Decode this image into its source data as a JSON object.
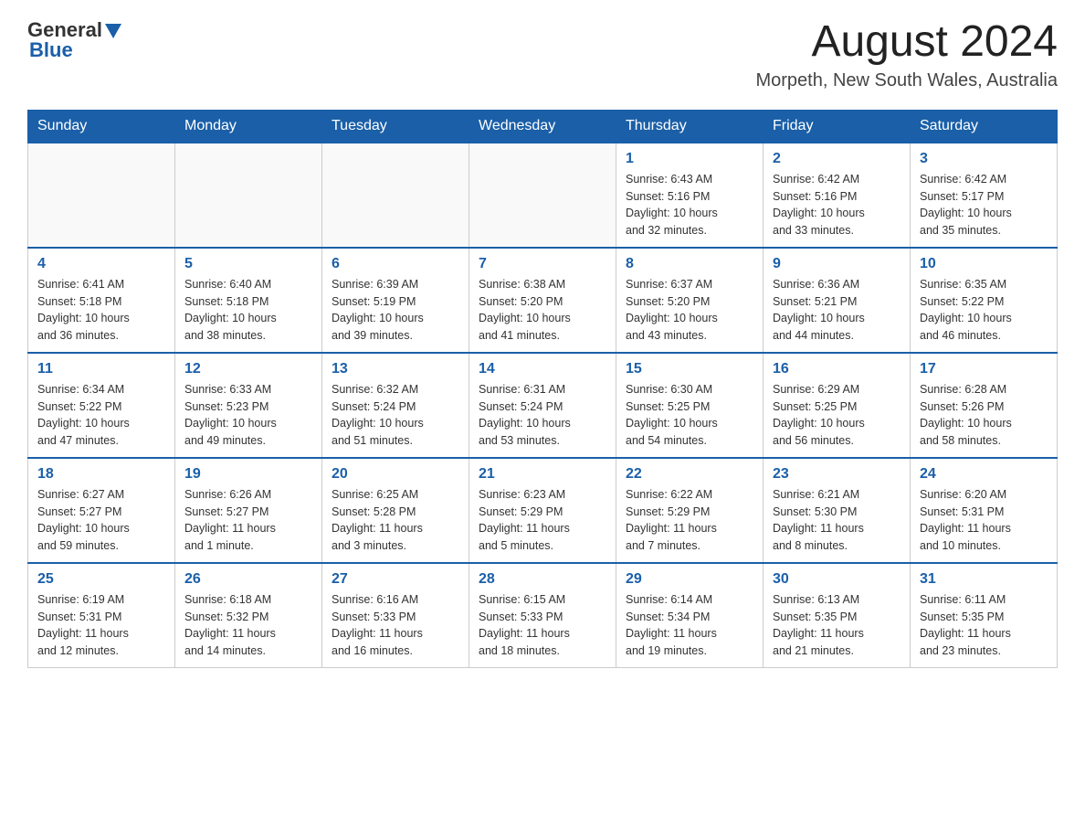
{
  "header": {
    "logo": {
      "general": "General",
      "blue": "Blue"
    },
    "title": "August 2024",
    "location": "Morpeth, New South Wales, Australia"
  },
  "days_of_week": [
    "Sunday",
    "Monday",
    "Tuesday",
    "Wednesday",
    "Thursday",
    "Friday",
    "Saturday"
  ],
  "weeks": [
    {
      "days": [
        {
          "number": "",
          "info": ""
        },
        {
          "number": "",
          "info": ""
        },
        {
          "number": "",
          "info": ""
        },
        {
          "number": "",
          "info": ""
        },
        {
          "number": "1",
          "info": "Sunrise: 6:43 AM\nSunset: 5:16 PM\nDaylight: 10 hours\nand 32 minutes."
        },
        {
          "number": "2",
          "info": "Sunrise: 6:42 AM\nSunset: 5:16 PM\nDaylight: 10 hours\nand 33 minutes."
        },
        {
          "number": "3",
          "info": "Sunrise: 6:42 AM\nSunset: 5:17 PM\nDaylight: 10 hours\nand 35 minutes."
        }
      ]
    },
    {
      "days": [
        {
          "number": "4",
          "info": "Sunrise: 6:41 AM\nSunset: 5:18 PM\nDaylight: 10 hours\nand 36 minutes."
        },
        {
          "number": "5",
          "info": "Sunrise: 6:40 AM\nSunset: 5:18 PM\nDaylight: 10 hours\nand 38 minutes."
        },
        {
          "number": "6",
          "info": "Sunrise: 6:39 AM\nSunset: 5:19 PM\nDaylight: 10 hours\nand 39 minutes."
        },
        {
          "number": "7",
          "info": "Sunrise: 6:38 AM\nSunset: 5:20 PM\nDaylight: 10 hours\nand 41 minutes."
        },
        {
          "number": "8",
          "info": "Sunrise: 6:37 AM\nSunset: 5:20 PM\nDaylight: 10 hours\nand 43 minutes."
        },
        {
          "number": "9",
          "info": "Sunrise: 6:36 AM\nSunset: 5:21 PM\nDaylight: 10 hours\nand 44 minutes."
        },
        {
          "number": "10",
          "info": "Sunrise: 6:35 AM\nSunset: 5:22 PM\nDaylight: 10 hours\nand 46 minutes."
        }
      ]
    },
    {
      "days": [
        {
          "number": "11",
          "info": "Sunrise: 6:34 AM\nSunset: 5:22 PM\nDaylight: 10 hours\nand 47 minutes."
        },
        {
          "number": "12",
          "info": "Sunrise: 6:33 AM\nSunset: 5:23 PM\nDaylight: 10 hours\nand 49 minutes."
        },
        {
          "number": "13",
          "info": "Sunrise: 6:32 AM\nSunset: 5:24 PM\nDaylight: 10 hours\nand 51 minutes."
        },
        {
          "number": "14",
          "info": "Sunrise: 6:31 AM\nSunset: 5:24 PM\nDaylight: 10 hours\nand 53 minutes."
        },
        {
          "number": "15",
          "info": "Sunrise: 6:30 AM\nSunset: 5:25 PM\nDaylight: 10 hours\nand 54 minutes."
        },
        {
          "number": "16",
          "info": "Sunrise: 6:29 AM\nSunset: 5:25 PM\nDaylight: 10 hours\nand 56 minutes."
        },
        {
          "number": "17",
          "info": "Sunrise: 6:28 AM\nSunset: 5:26 PM\nDaylight: 10 hours\nand 58 minutes."
        }
      ]
    },
    {
      "days": [
        {
          "number": "18",
          "info": "Sunrise: 6:27 AM\nSunset: 5:27 PM\nDaylight: 10 hours\nand 59 minutes."
        },
        {
          "number": "19",
          "info": "Sunrise: 6:26 AM\nSunset: 5:27 PM\nDaylight: 11 hours\nand 1 minute."
        },
        {
          "number": "20",
          "info": "Sunrise: 6:25 AM\nSunset: 5:28 PM\nDaylight: 11 hours\nand 3 minutes."
        },
        {
          "number": "21",
          "info": "Sunrise: 6:23 AM\nSunset: 5:29 PM\nDaylight: 11 hours\nand 5 minutes."
        },
        {
          "number": "22",
          "info": "Sunrise: 6:22 AM\nSunset: 5:29 PM\nDaylight: 11 hours\nand 7 minutes."
        },
        {
          "number": "23",
          "info": "Sunrise: 6:21 AM\nSunset: 5:30 PM\nDaylight: 11 hours\nand 8 minutes."
        },
        {
          "number": "24",
          "info": "Sunrise: 6:20 AM\nSunset: 5:31 PM\nDaylight: 11 hours\nand 10 minutes."
        }
      ]
    },
    {
      "days": [
        {
          "number": "25",
          "info": "Sunrise: 6:19 AM\nSunset: 5:31 PM\nDaylight: 11 hours\nand 12 minutes."
        },
        {
          "number": "26",
          "info": "Sunrise: 6:18 AM\nSunset: 5:32 PM\nDaylight: 11 hours\nand 14 minutes."
        },
        {
          "number": "27",
          "info": "Sunrise: 6:16 AM\nSunset: 5:33 PM\nDaylight: 11 hours\nand 16 minutes."
        },
        {
          "number": "28",
          "info": "Sunrise: 6:15 AM\nSunset: 5:33 PM\nDaylight: 11 hours\nand 18 minutes."
        },
        {
          "number": "29",
          "info": "Sunrise: 6:14 AM\nSunset: 5:34 PM\nDaylight: 11 hours\nand 19 minutes."
        },
        {
          "number": "30",
          "info": "Sunrise: 6:13 AM\nSunset: 5:35 PM\nDaylight: 11 hours\nand 21 minutes."
        },
        {
          "number": "31",
          "info": "Sunrise: 6:11 AM\nSunset: 5:35 PM\nDaylight: 11 hours\nand 23 minutes."
        }
      ]
    }
  ]
}
